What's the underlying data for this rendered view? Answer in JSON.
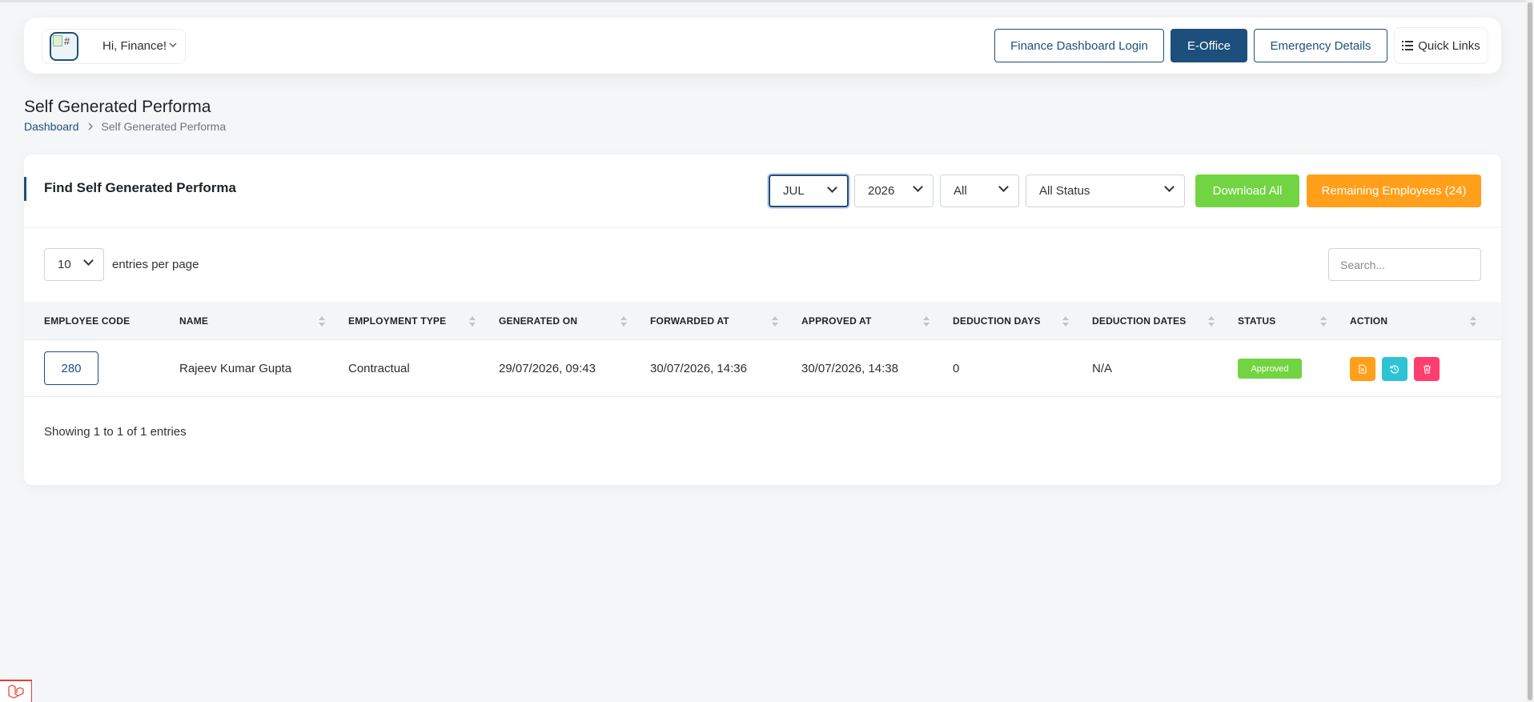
{
  "header": {
    "greeting": "Hi, Finance!",
    "avatar_alt": "#",
    "buttons": {
      "finance_dashboard_login": "Finance Dashboard Login",
      "e_office": "E-Office",
      "emergency_details": "Emergency Details",
      "quick_links": "Quick Links"
    }
  },
  "page": {
    "title": "Self Generated Performa",
    "breadcrumb": [
      "Dashboard",
      "Self Generated Performa"
    ]
  },
  "card": {
    "title": "Find Self Generated Performa",
    "filters": {
      "month": "JUL",
      "year": "2026",
      "type": "All",
      "status": "All Status"
    },
    "download_all_label": "Download All",
    "remaining_label": "Remaining Employees (24)",
    "per_page_value": "10",
    "per_page_label": "entries per page",
    "search_placeholder": "Search...",
    "table": {
      "headers": [
        "EMPLOYEE CODE",
        "NAME",
        "EMPLOYMENT TYPE",
        "GENERATED ON",
        "FORWARDED AT",
        "APPROVED AT",
        "DEDUCTION DAYS",
        "DEDUCTION DATES",
        "STATUS",
        "ACTION"
      ],
      "rows": [
        {
          "employee_code": "280",
          "name": "Rajeev Kumar Gupta",
          "employment_type": "Contractual",
          "generated_on": "29/07/2026, 09:43",
          "forwarded_at": "30/07/2026, 14:36",
          "approved_at": "30/07/2026, 14:38",
          "deduction_days": "0",
          "deduction_dates": "N/A",
          "status": "Approved",
          "actions": [
            "document-icon",
            "history-icon",
            "trash-icon"
          ]
        }
      ]
    },
    "showing_text": "Showing 1 to 1 of 1 entries"
  },
  "colors": {
    "primary": "#1d4f7c",
    "success": "#72d442",
    "warning": "#ff9f1a",
    "info": "#2fc4d3",
    "danger": "#ff3d6e"
  }
}
